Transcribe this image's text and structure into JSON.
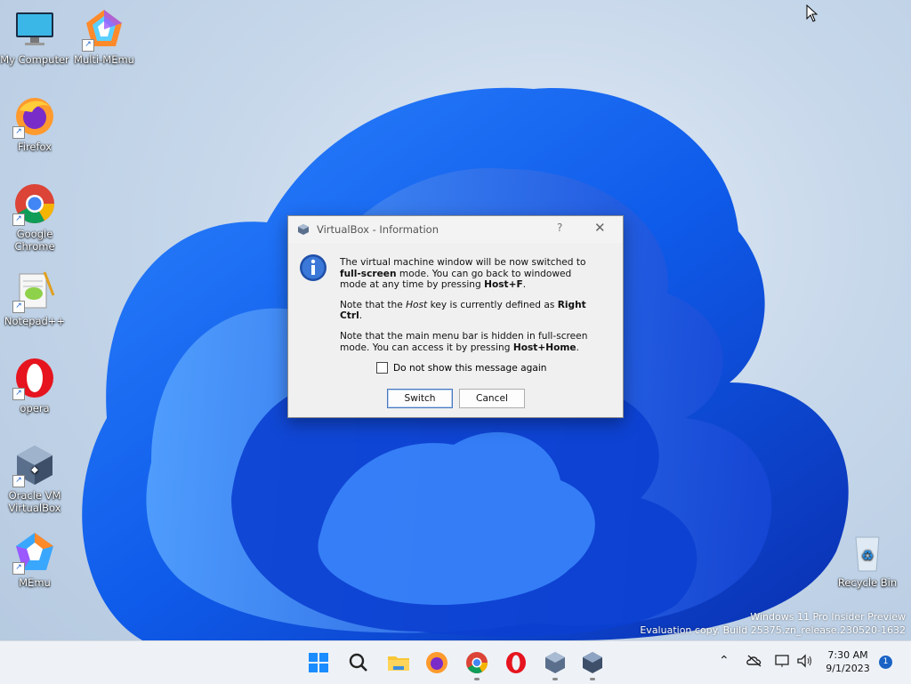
{
  "desktop": {
    "icons": [
      {
        "label": "My Computer",
        "icon": "monitor-icon"
      },
      {
        "label": "Multi-MEmu",
        "icon": "multi-memu-icon"
      },
      {
        "label": "Firefox",
        "icon": "firefox-icon"
      },
      {
        "label": "Google Chrome",
        "icon": "chrome-icon"
      },
      {
        "label": "Notepad++",
        "icon": "notepadpp-icon"
      },
      {
        "label": "opera",
        "icon": "opera-icon"
      },
      {
        "label": "Oracle VM VirtualBox",
        "icon": "virtualbox-icon"
      },
      {
        "label": "MEmu",
        "icon": "memu-icon"
      },
      {
        "label": "Recycle Bin",
        "icon": "recycle-bin-icon"
      }
    ],
    "watermark": {
      "line1": "Windows 11 Pro Insider Preview",
      "line2": "Evaluation copy. Build 25375.zn_release.230520-1632"
    }
  },
  "dialog": {
    "title": "VirtualBox - Information",
    "help": "?",
    "close": "✕",
    "p1_a": "The virtual machine window will be now switched to ",
    "p1_b": "full-screen",
    "p1_c": " mode. You can go back to windowed mode at any time by pressing ",
    "p1_d": "Host+F",
    "p1_e": ".",
    "p2_a": "Note that the ",
    "p2_b": "Host",
    "p2_c": " key is currently defined as ",
    "p2_d": "Right Ctrl",
    "p2_e": ".",
    "p3_a": "Note that the main menu bar is hidden in full-screen mode. You can access it by pressing ",
    "p3_b": "Host+Home",
    "p3_c": ".",
    "checkbox_label": "Do not show this message again",
    "checkbox_checked": false,
    "switch_label": "Switch",
    "cancel_label": "Cancel"
  },
  "taskbar": {
    "apps": [
      "windows-start-icon",
      "search-icon",
      "file-explorer-icon",
      "firefox-icon",
      "chrome-icon",
      "opera-icon",
      "virtualbox-icon",
      "virtualbox-vm-icon"
    ],
    "time": "7:30 AM",
    "date": "9/1/2023",
    "notifications": "1",
    "colors": {
      "accent": "#1a63c5",
      "taskbar": "#eef2f7"
    }
  }
}
